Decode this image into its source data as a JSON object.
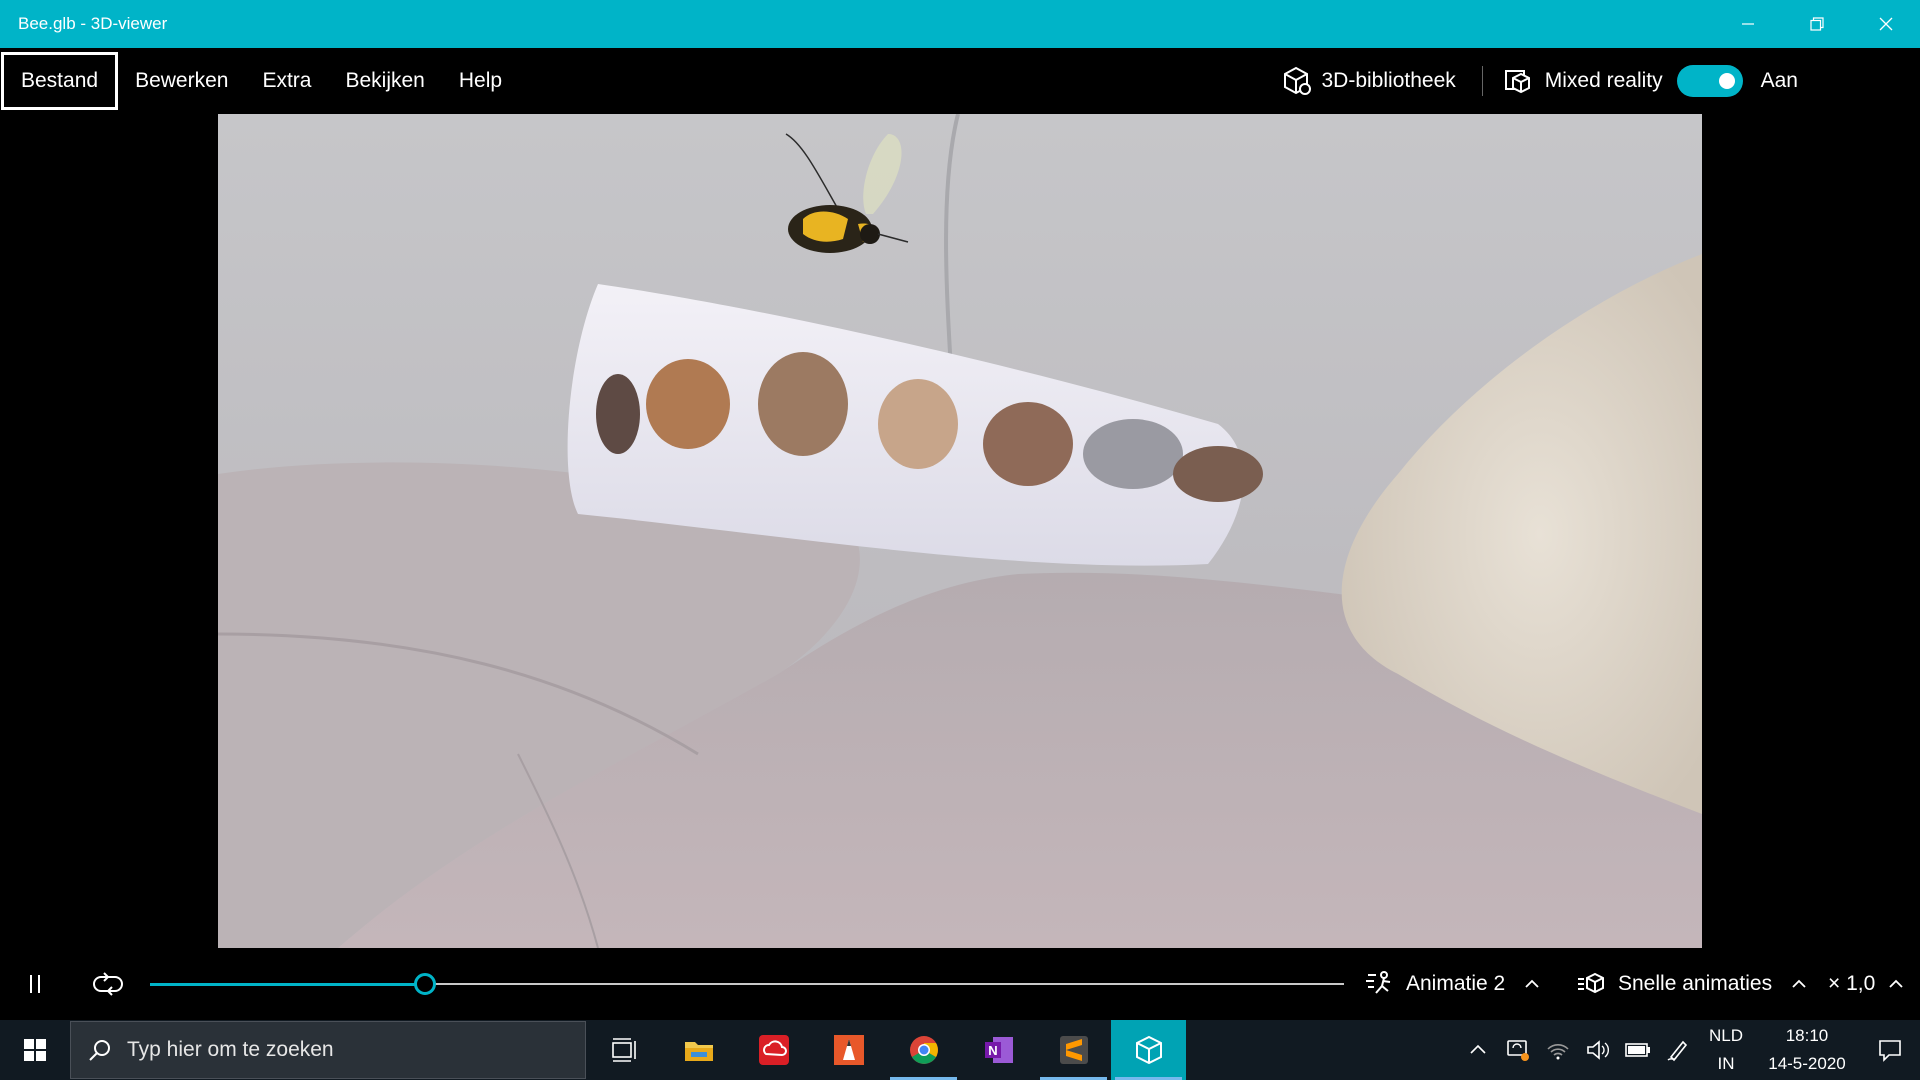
{
  "window": {
    "title": "Bee.glb - 3D-viewer",
    "accent": "#00b4c8"
  },
  "menu": {
    "items": [
      {
        "label": "Bestand"
      },
      {
        "label": "Bewerken"
      },
      {
        "label": "Extra"
      },
      {
        "label": "Bekijken"
      },
      {
        "label": "Help"
      }
    ],
    "library_label": "3D-bibliotheek",
    "mixed_reality_label": "Mixed reality",
    "toggle_state_label": "Aan"
  },
  "playback": {
    "progress": 0.23,
    "animation_label": "Animatie 2",
    "quick_animations_label": "Snelle animaties",
    "speed_label": "× 1,0"
  },
  "taskbar": {
    "search_placeholder": "Typ hier om te zoeken",
    "apps": [
      "task-view-icon",
      "file-explorer-icon",
      "creative-cloud-icon",
      "paint-app-icon",
      "chrome-icon",
      "onenote-icon",
      "sublime-text-icon",
      "3d-viewer-icon"
    ],
    "language_top": "NLD",
    "language_bottom": "IN",
    "time": "18:10",
    "date": "14-5-2020"
  }
}
